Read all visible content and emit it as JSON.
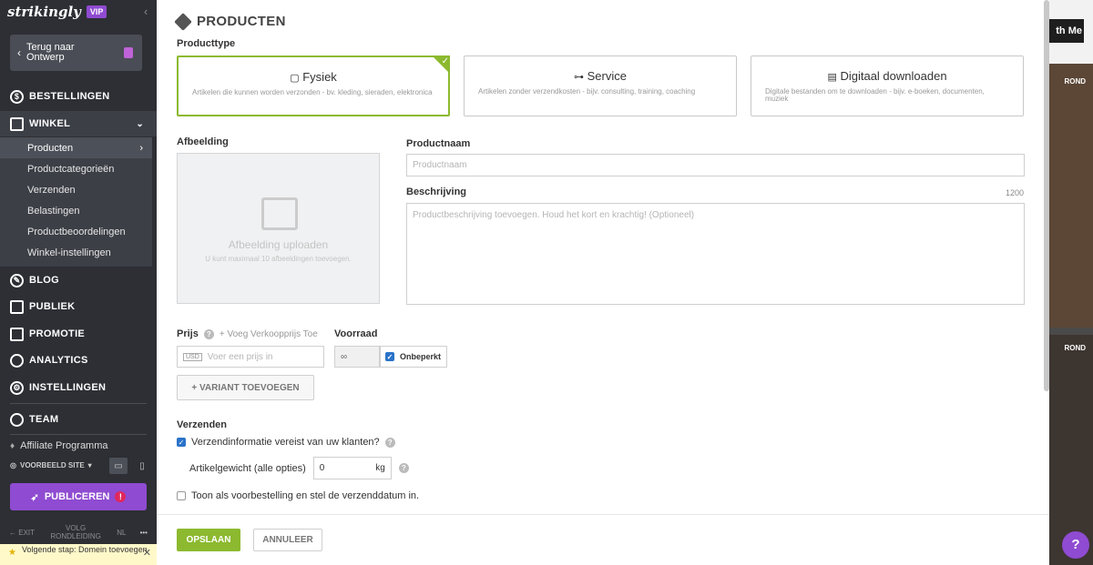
{
  "sidebar": {
    "logo": "strikingly",
    "vip": "VIP",
    "back_label": "Terug naar Ontwerp",
    "nav": {
      "orders": "BESTELLINGEN",
      "store": "WINKEL",
      "blog": "BLOG",
      "audience": "PUBLIEK",
      "promotion": "PROMOTIE",
      "analytics": "ANALYTICS",
      "settings": "INSTELLINGEN",
      "team": "TEAM",
      "affiliate": "Affiliate Programma"
    },
    "store_items": [
      "Producten",
      "Productcategorieën",
      "Verzenden",
      "Belastingen",
      "Productbeoordelingen",
      "Winkel-instellingen"
    ],
    "preview_site": "VOORBEELD SITE",
    "publish": "PUBLICEREN",
    "publish_alert": "!",
    "exit": "EXIT",
    "tour": "VOLG RONDLEIDING",
    "lang": "NL",
    "more": "•••",
    "next_step": "Volgende stap: Domein toevoegen"
  },
  "site": {
    "button": "th Me",
    "label1": "ROND",
    "label2": "ROND",
    "help": "?"
  },
  "modal": {
    "title": "PRODUCTEN",
    "product_type_label": "Producttype",
    "types": [
      {
        "title": "Fysiek",
        "desc": "Artikelen die kunnen worden verzonden - bv. kleding, sieraden, elektronica"
      },
      {
        "title": "Service",
        "desc": "Artikelen zonder verzendkosten - bijv. consulting, training, coaching"
      },
      {
        "title": "Digitaal downloaden",
        "desc": "Digitale bestanden om te downloaden - bijv. e-boeken, documenten, muziek"
      }
    ],
    "image_label": "Afbeelding",
    "image_upload": "Afbeelding uploaden",
    "image_hint": "U kunt maximaal 10 afbeeldingen toevoegen.",
    "name_label": "Productnaam",
    "name_placeholder": "Productnaam",
    "desc_label": "Beschrijving",
    "desc_count": "1200",
    "desc_placeholder": "Productbeschrijving toevoegen. Houd het kort en krachtig! (Optioneel)",
    "price_label": "Prijs",
    "add_sale_price": "+ Voeg Verkoopprijs Toe",
    "currency": "USD",
    "price_placeholder": "Voer een prijs in",
    "stock_label": "Voorraad",
    "stock_value": "∞",
    "unlimited": "Onbeperkt",
    "add_variant": "+ VARIANT TOEVOEGEN",
    "shipping_label": "Verzenden",
    "shipping_required": "Verzendinformatie vereist van uw klanten?",
    "weight_label": "Artikelgewicht (alle opties)",
    "weight_value": "0",
    "weight_unit": "kg",
    "preorder": "Toon als voorbestelling en stel de verzenddatum in.",
    "save": "OPSLAAN",
    "cancel": "ANNULEER"
  }
}
